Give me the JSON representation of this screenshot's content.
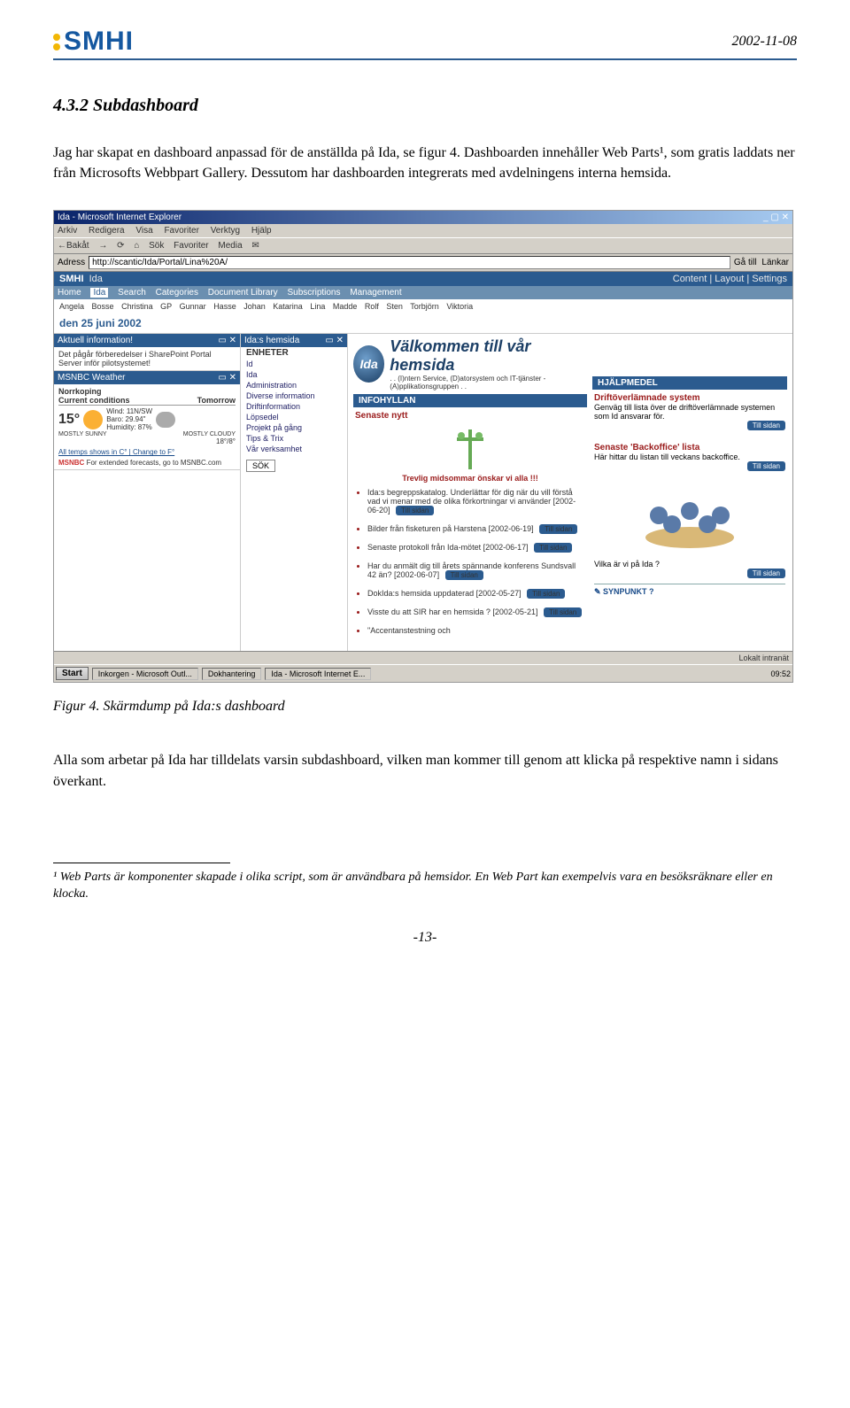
{
  "header": {
    "logo_text": "SMHI",
    "date": "2002-11-08"
  },
  "section": {
    "heading": "4.3.2 Subdashboard",
    "para1": "Jag har skapat en dashboard anpassad för de anställda på Ida, se figur 4. Dashboarden innehåller Web Parts¹, som gratis laddats ner från Microsofts Webbpart Gallery. Dessutom har dashboarden integrerats med avdelningens interna hemsida."
  },
  "screenshot": {
    "window_title": "Ida - Microsoft Internet Explorer",
    "menubar": [
      "Arkiv",
      "Redigera",
      "Visa",
      "Favoriter",
      "Verktyg",
      "Hjälp"
    ],
    "toolbar": [
      "←Bakåt",
      "→",
      "⟳",
      "⌂",
      "Sök",
      "Favoriter",
      "Media",
      "✉"
    ],
    "address_label": "Adress",
    "address_url": "http://scantic/Ida/Portal/Lina%20A/",
    "go_label": "Gå till",
    "links_label": "Länkar",
    "topbar": {
      "ida": "Ida",
      "right": "Content | Layout | Settings"
    },
    "tabbar": [
      "Home",
      "Ida",
      "Search",
      "Categories",
      "Document Library",
      "Subscriptions",
      "Management"
    ],
    "names": [
      "Angela",
      "Bosse",
      "Christina",
      "GP",
      "Gunnar",
      "Hasse",
      "Johan",
      "Katarina",
      "Lina",
      "Madde",
      "Rolf",
      "Sten",
      "Torbjörn",
      "Viktoria"
    ],
    "datebar": "den 25 juni 2002",
    "left_panels": {
      "aktuell_title": "Aktuell information!",
      "aktuell_body": "Det pågår förberedelser i SharePoint Portal Server inför pilotsystemet!",
      "weather_title": "MSNBC Weather",
      "weather_city": "Norrkoping",
      "weather_current_label": "Current conditions",
      "weather_tomorrow_label": "Tomorrow",
      "weather_temp": "15°",
      "weather_today": "MOSTLY SUNNY",
      "weather_tomorrow": "MOSTLY CLOUDY",
      "weather_details": [
        "Wind: 11N/SW",
        "Baro: 29.94\"",
        "Humidity: 87%",
        "18°/8°"
      ],
      "weather_link": "All temps shows in C° | Change to F°",
      "weather_link2": "For extended forecasts, go to MSNBC.com"
    },
    "mid_title": "Ida:s hemsida",
    "mid_header": "ENHETER",
    "mid_items": [
      "Id",
      "Ida",
      "Administration",
      "Diverse information",
      "Driftinformation",
      "Löpsedel",
      "Projekt på gång",
      "Tips & Trix",
      "Vår verksamhet"
    ],
    "mid_sok": "SÖK",
    "main": {
      "welcome_title": "Välkommen till vår hemsida",
      "welcome_sub": ". . (I)ntern Service, (D)atorsystem och IT-tjänster - (A)pplikationsgruppen . .",
      "infohyllan": "INFOHYLLAN",
      "senaste_nytt": "Senaste nytt",
      "midsommar": "Trevlig midsommar önskar vi alla !!!",
      "news": [
        "Ida:s begreppskatalog. Underlättar för dig när du vill förstå vad vi menar med de olika förkortningar vi använder [2002-06-20]",
        "Bilder från fisketuren på Harstena [2002-06-19]",
        "Senaste protokoll från Ida-mötet [2002-06-17]",
        "Har du anmält dig till årets spännande konferens Sundsvall 42 än? [2002-06-07]",
        "DokIda:s hemsida uppdaterad [2002-05-27]",
        "Visste du att SIR har en hemsida ? [2002-05-21]",
        "\"Accentanstestning och"
      ],
      "till_sidan": "Till sidan"
    },
    "right": {
      "hjalpmedel": "HJÄLPMEDEL",
      "drift_title": "Driftöverlämnade system",
      "drift_body": "Genväg till lista över de driftöverlämnade systemen som Id ansvarar för.",
      "backoffice_title": "Senaste 'Backoffice' lista",
      "backoffice_body": "Här hittar du listan till veckans backoffice.",
      "vilka": "Vilka är vi på Ida ?",
      "synpunkt": "SYNPUNKT ?"
    },
    "statusbar_right": "Lokalt intranät",
    "taskbar": {
      "start": "Start",
      "items": [
        "Inkorgen - Microsoft Outl...",
        "Dokhantering",
        "Ida - Microsoft Internet E..."
      ],
      "clock": "09:52"
    }
  },
  "figure_caption": "Figur 4. Skärmdump på Ida:s dashboard",
  "para2": "Alla som arbetar på Ida har tilldelats varsin subdashboard, vilken man kommer till genom att klicka på respektive namn i sidans överkant.",
  "footnote": "¹ Web Parts är komponenter skapade i olika script, som är användbara på hemsidor. En Web Part kan exempelvis vara en besöksräknare eller en klocka.",
  "page_number": "-13-"
}
